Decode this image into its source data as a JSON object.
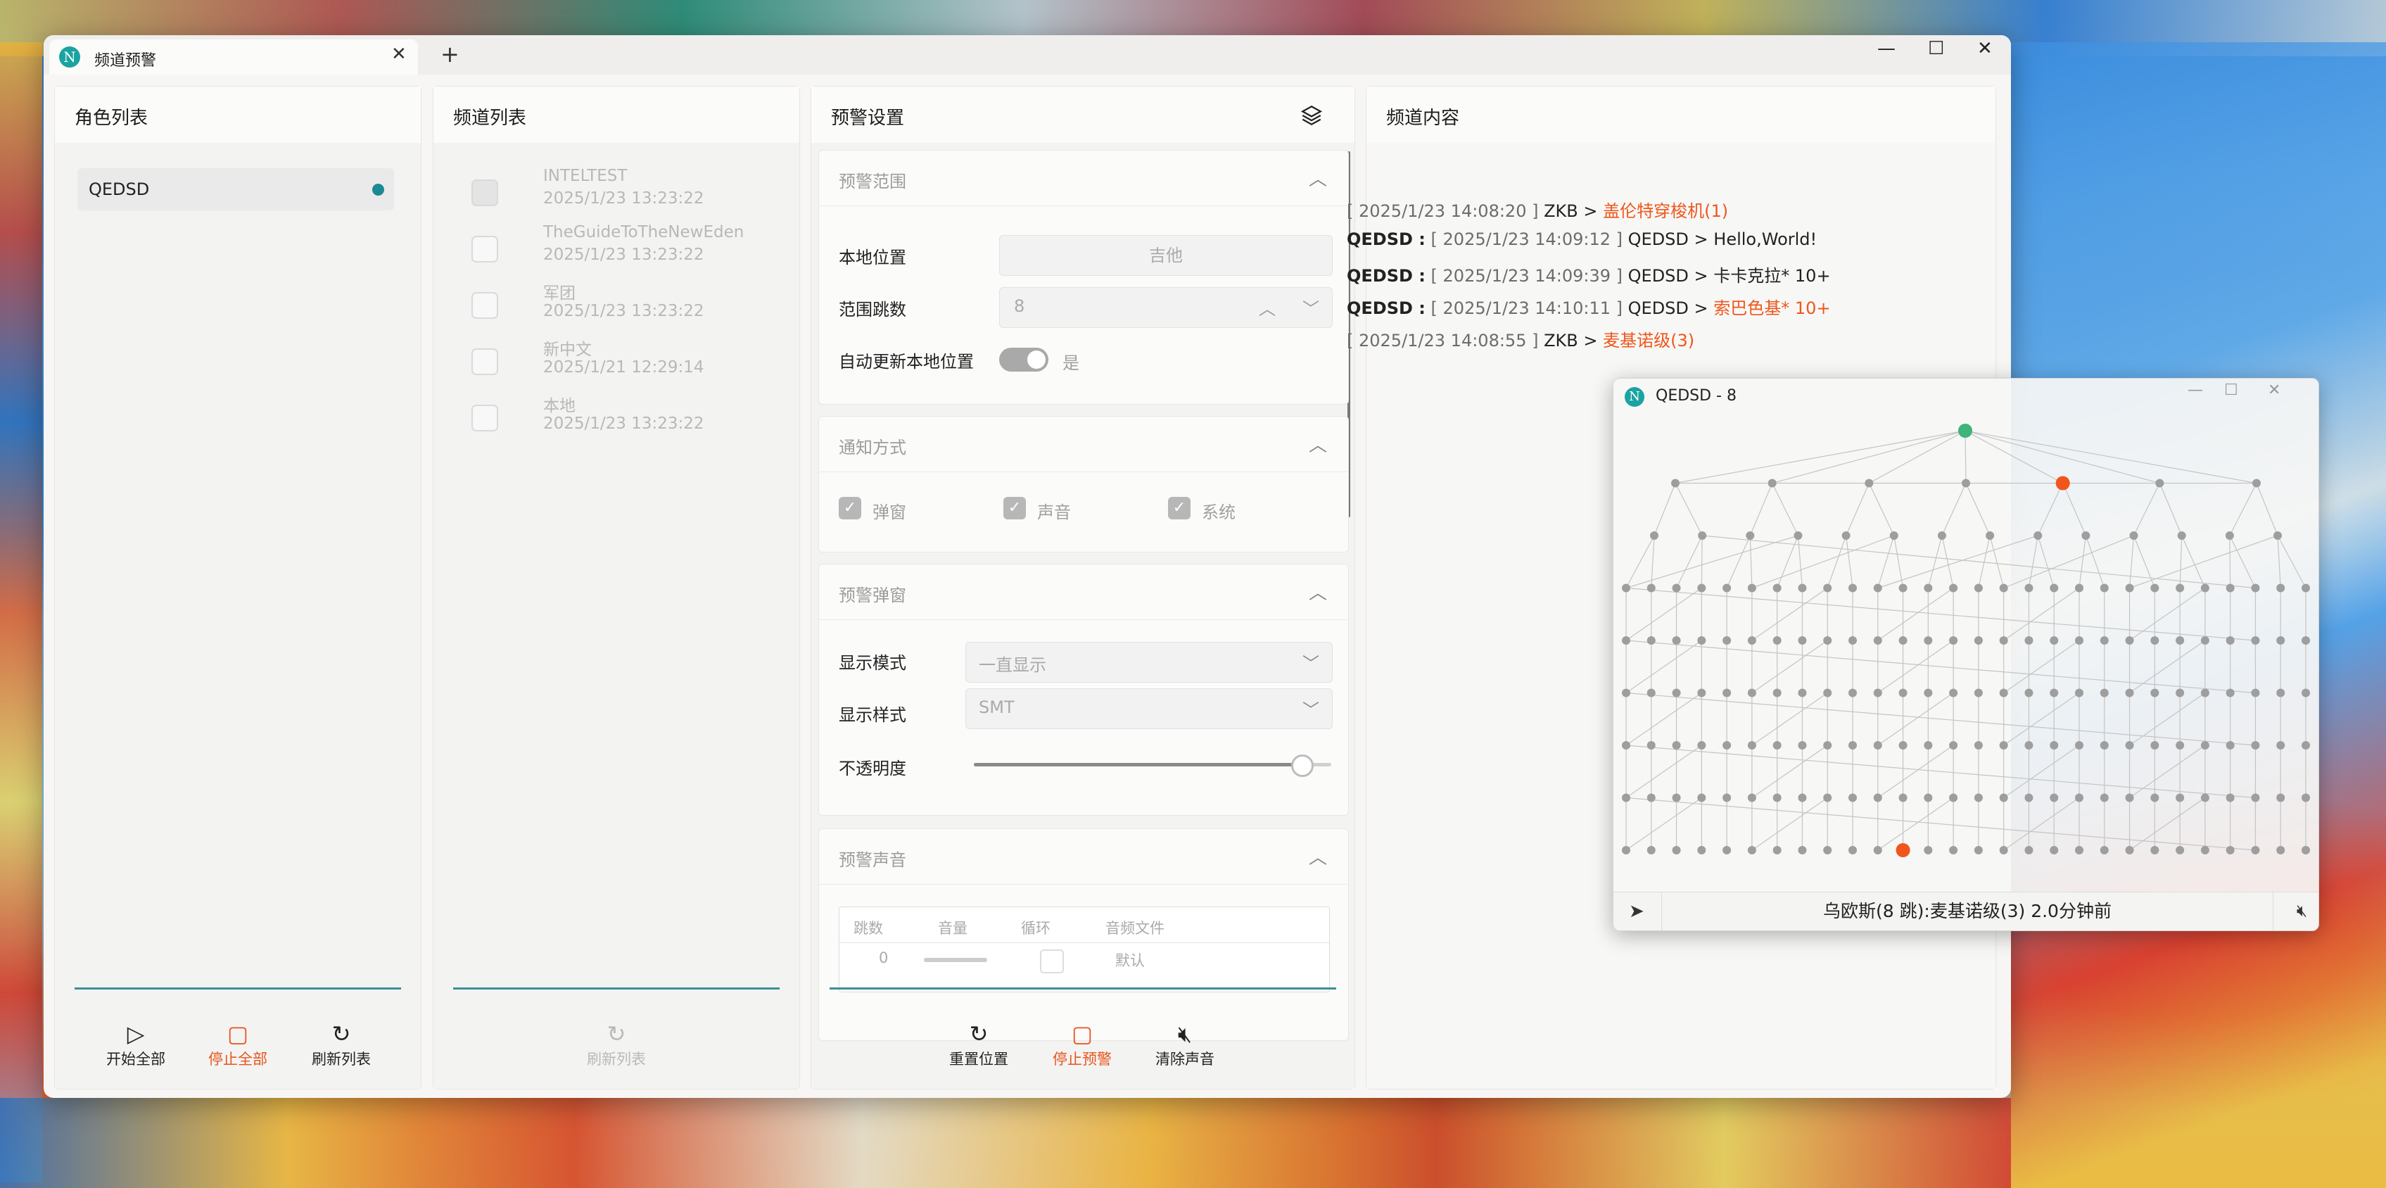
{
  "colors": {
    "accent": "#1b8a93",
    "warn": "#e8541c",
    "alert_node": "#f0561b",
    "origin_node": "#3eb37a",
    "node": "#9e9e9e"
  },
  "window": {
    "tab_title": "频道预警",
    "app_icon_letter": "N",
    "add_tab": "+",
    "close_tab": "✕",
    "controls": {
      "minimize": "—",
      "maximize": "☐",
      "close": "✕"
    }
  },
  "roles": {
    "title": "角色列表",
    "items": [
      {
        "name": "QEDSD",
        "active": true
      }
    ],
    "buttons": {
      "start_all": "开始全部",
      "stop_all": "停止全部",
      "refresh": "刷新列表"
    }
  },
  "channels": {
    "title": "频道列表",
    "items": [
      {
        "name": "INTELTEST",
        "time": "2025/1/23 13:23:22"
      },
      {
        "name": "TheGuideToTheNewEden",
        "time": "2025/1/23 13:23:22"
      },
      {
        "name": "军团",
        "time": "2025/1/23 13:23:22"
      },
      {
        "name": "新中文",
        "time": "2025/1/21 12:29:14"
      },
      {
        "name": "本地",
        "time": "2025/1/23 13:23:22"
      }
    ],
    "refresh": "刷新列表"
  },
  "settings": {
    "title": "预警设置",
    "range": {
      "title": "预警范围",
      "local_label": "本地位置",
      "local_value": "吉他",
      "jumps_label": "范围跳数",
      "jumps_value": "8",
      "auto_label": "自动更新本地位置",
      "auto_value": "是"
    },
    "notify": {
      "title": "通知方式",
      "popup": "弹窗",
      "sound": "声音",
      "system": "系统"
    },
    "popup": {
      "title": "预警弹窗",
      "mode_label": "显示模式",
      "mode_value": "一直显示",
      "style_label": "显示样式",
      "style_value": "SMT",
      "opacity_label": "不透明度",
      "opacity": 0.92
    },
    "sound": {
      "title": "预警声音",
      "columns": [
        "跳数",
        "音量",
        "循环",
        "音频文件"
      ],
      "first_row_jumps": "0",
      "first_row_file": "默认"
    },
    "buttons": {
      "reset": "重置位置",
      "stop": "停止预警",
      "clear_sound": "清除声音"
    }
  },
  "content": {
    "title": "频道内容",
    "messages": [
      {
        "who": "",
        "time": "[ 2025/1/23 14:08:20 ]",
        "from": "ZKB >",
        "text": "盖伦特穿梭机(1)",
        "red": true
      },
      {
        "who": "QEDSD :",
        "time": "[ 2025/1/23 14:09:12 ]",
        "from": "QEDSD >",
        "text": "Hello,World!",
        "red": false
      },
      {
        "who": "QEDSD :",
        "time": "[ 2025/1/23 14:09:39 ]",
        "from": "QEDSD >",
        "text": "卡卡克拉* 10+",
        "red": false
      },
      {
        "who": "QEDSD :",
        "time": "[ 2025/1/23 14:10:11 ]",
        "from": "QEDSD >",
        "text": "索巴色基* 10+",
        "red": true
      },
      {
        "who": "",
        "time": "[ 2025/1/23 14:08:55 ]",
        "from": "ZKB >",
        "text": "麦基诺级(3)",
        "red": true
      }
    ]
  },
  "map_window": {
    "title": "QEDSD - 8",
    "status": "乌欧斯(8 跳):麦基诺级(3) 2.0分钟前",
    "row_counts": [
      1,
      7,
      14,
      28,
      28,
      28,
      28,
      28,
      28
    ],
    "alert_nodes": [
      [
        1,
        4
      ],
      [
        8,
        11
      ]
    ]
  }
}
